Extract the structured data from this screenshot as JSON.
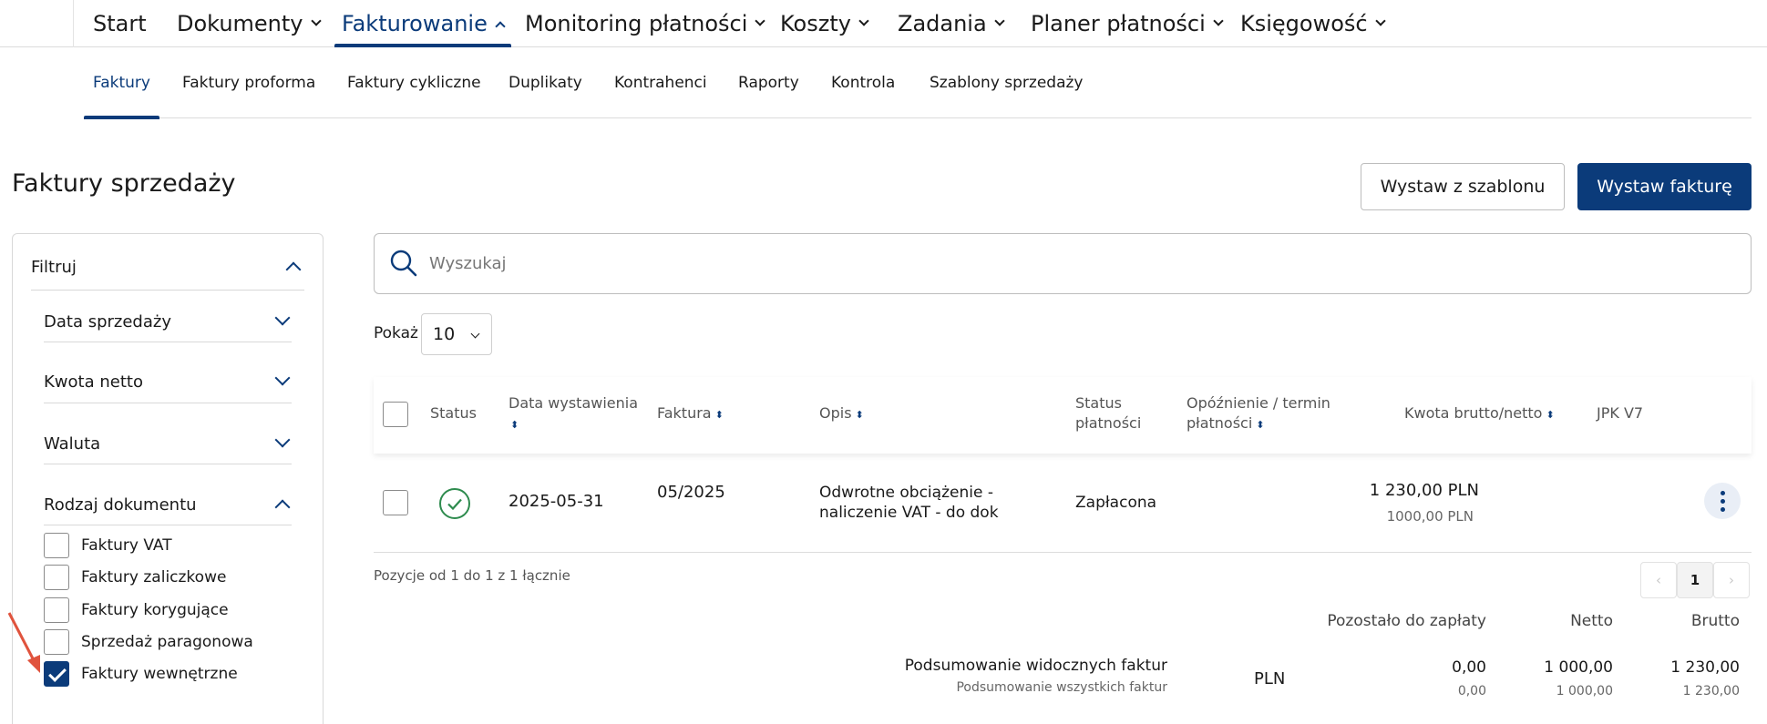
{
  "topnav": {
    "items": [
      {
        "label": "Start"
      },
      {
        "label": "Dokumenty"
      },
      {
        "label": "Fakturowanie"
      },
      {
        "label": "Monitoring płatności"
      },
      {
        "label": "Koszty"
      },
      {
        "label": "Zadania"
      },
      {
        "label": "Planer płatności"
      },
      {
        "label": "Księgowość"
      }
    ],
    "active": "Fakturowanie"
  },
  "subnav": {
    "items": [
      "Faktury",
      "Faktury proforma",
      "Faktury cykliczne",
      "Duplikaty",
      "Kontrahenci",
      "Raporty",
      "Kontrola",
      "Szablony sprzedaży"
    ],
    "active": "Faktury"
  },
  "page": {
    "title": "Faktury sprzedaży",
    "btn_template": "Wystaw z szablonu",
    "btn_invoice": "Wystaw fakturę"
  },
  "filter": {
    "title": "Filtruj",
    "sections": [
      "Data sprzedaży",
      "Kwota netto",
      "Waluta",
      "Rodzaj dokumentu"
    ],
    "doc_types": [
      {
        "label": "Faktury VAT",
        "checked": false
      },
      {
        "label": "Faktury zaliczkowe",
        "checked": false
      },
      {
        "label": "Faktury korygujące",
        "checked": false
      },
      {
        "label": "Sprzedaż paragonowa",
        "checked": false
      },
      {
        "label": "Faktury wewnętrzne",
        "checked": true
      }
    ]
  },
  "search": {
    "placeholder": "Wyszukaj"
  },
  "pagesize": {
    "label": "Pokaż",
    "value": "10"
  },
  "table": {
    "headers": {
      "status": "Status",
      "date": "Data wystawienia",
      "invoice": "Faktura",
      "desc": "Opis",
      "pay_status_1": "Status",
      "pay_status_2": "płatności",
      "delay_1": "Opóźnienie / termin",
      "delay_2": "płatności",
      "amount": "Kwota brutto/netto",
      "jpk": "JPK V7"
    },
    "rows": [
      {
        "date": "2025-05-31",
        "invoice": "05/2025",
        "desc_1": "Odwrotne obciążenie -",
        "desc_2": "naliczenie VAT - do dok",
        "pay_status": "Zapłacona",
        "gross": "1 230,00 PLN",
        "net": "1000,00 PLN"
      }
    ],
    "range_text": "Pozycje od 1 do 1 z 1 łącznie"
  },
  "pagination": {
    "prev": "‹",
    "current": "1",
    "next": "›"
  },
  "summary": {
    "headers": {
      "remaining": "Pozostało do zapłaty",
      "net": "Netto",
      "gross": "Brutto"
    },
    "visible_label": "Podsumowanie widocznych faktur",
    "all_label": "Podsumowanie wszystkich faktur",
    "currency": "PLN",
    "visible": {
      "remaining": "0,00",
      "net": "1 000,00",
      "gross": "1 230,00"
    },
    "all": {
      "remaining": "0,00",
      "net": "1 000,00",
      "gross": "1 230,00"
    }
  },
  "colors": {
    "primary": "#0b3b7a",
    "success": "#2e8b4e"
  }
}
